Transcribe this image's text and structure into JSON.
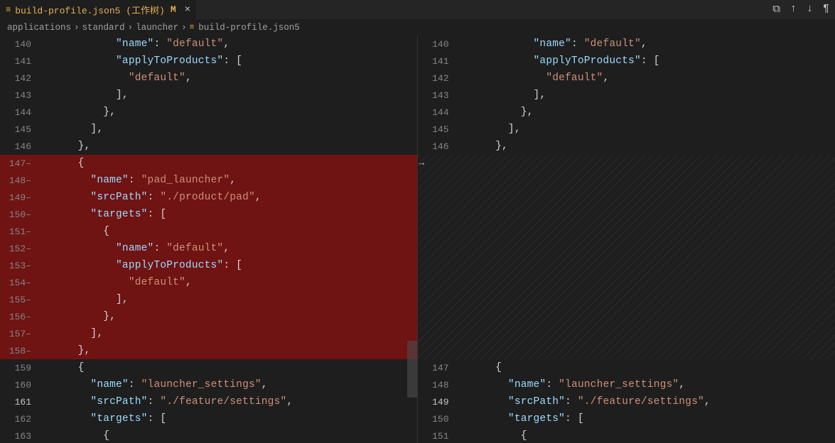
{
  "tab": {
    "filename": "build-profile.json5 (工作树)",
    "modifier": "M"
  },
  "toolbar": {
    "icon1": "⧉",
    "icon2": "↑",
    "icon3": "↓",
    "icon4": "¶"
  },
  "breadcrumb": {
    "segments": [
      "applications",
      "standard",
      "launcher"
    ],
    "file": "build-profile.json5"
  },
  "left": {
    "lines": [
      {
        "n": "140",
        "indent": 10,
        "removed": false,
        "tokens": [
          {
            "t": "key",
            "v": "\"name\""
          },
          {
            "t": "punct",
            "v": ": "
          },
          {
            "t": "string",
            "v": "\"default\""
          },
          {
            "t": "punct",
            "v": ","
          }
        ]
      },
      {
        "n": "141",
        "indent": 10,
        "removed": false,
        "tokens": [
          {
            "t": "key",
            "v": "\"applyToProducts\""
          },
          {
            "t": "punct",
            "v": ": ["
          }
        ]
      },
      {
        "n": "142",
        "indent": 12,
        "removed": false,
        "tokens": [
          {
            "t": "string",
            "v": "\"default\""
          },
          {
            "t": "punct",
            "v": ","
          }
        ]
      },
      {
        "n": "143",
        "indent": 10,
        "removed": false,
        "tokens": [
          {
            "t": "punct",
            "v": "],"
          }
        ]
      },
      {
        "n": "144",
        "indent": 8,
        "removed": false,
        "tokens": [
          {
            "t": "punct",
            "v": "},"
          }
        ]
      },
      {
        "n": "145",
        "indent": 6,
        "removed": false,
        "tokens": [
          {
            "t": "punct",
            "v": "],"
          }
        ]
      },
      {
        "n": "146",
        "indent": 4,
        "removed": false,
        "tokens": [
          {
            "t": "punct",
            "v": "},"
          }
        ]
      },
      {
        "n": "147",
        "indent": 4,
        "removed": true,
        "suffix": "–",
        "tokens": [
          {
            "t": "punct",
            "v": "{"
          }
        ]
      },
      {
        "n": "148",
        "indent": 6,
        "removed": true,
        "suffix": "–",
        "tokens": [
          {
            "t": "key",
            "v": "\"name\""
          },
          {
            "t": "punct",
            "v": ": "
          },
          {
            "t": "string",
            "v": "\"pad_launcher\""
          },
          {
            "t": "punct",
            "v": ","
          }
        ]
      },
      {
        "n": "149",
        "indent": 6,
        "removed": true,
        "suffix": "–",
        "tokens": [
          {
            "t": "key",
            "v": "\"srcPath\""
          },
          {
            "t": "punct",
            "v": ": "
          },
          {
            "t": "string",
            "v": "\"./product/pad\""
          },
          {
            "t": "punct",
            "v": ","
          }
        ]
      },
      {
        "n": "150",
        "indent": 6,
        "removed": true,
        "suffix": "–",
        "tokens": [
          {
            "t": "key",
            "v": "\"targets\""
          },
          {
            "t": "punct",
            "v": ": ["
          }
        ]
      },
      {
        "n": "151",
        "indent": 8,
        "removed": true,
        "suffix": "–",
        "tokens": [
          {
            "t": "punct",
            "v": "{"
          }
        ]
      },
      {
        "n": "152",
        "indent": 10,
        "removed": true,
        "suffix": "–",
        "tokens": [
          {
            "t": "key",
            "v": "\"name\""
          },
          {
            "t": "punct",
            "v": ": "
          },
          {
            "t": "string",
            "v": "\"default\""
          },
          {
            "t": "punct",
            "v": ","
          }
        ]
      },
      {
        "n": "153",
        "indent": 10,
        "removed": true,
        "suffix": "–",
        "tokens": [
          {
            "t": "key",
            "v": "\"applyToProducts\""
          },
          {
            "t": "punct",
            "v": ": ["
          }
        ]
      },
      {
        "n": "154",
        "indent": 12,
        "removed": true,
        "suffix": "–",
        "tokens": [
          {
            "t": "string",
            "v": "\"default\""
          },
          {
            "t": "punct",
            "v": ","
          }
        ]
      },
      {
        "n": "155",
        "indent": 10,
        "removed": true,
        "suffix": "–",
        "tokens": [
          {
            "t": "punct",
            "v": "],"
          }
        ]
      },
      {
        "n": "156",
        "indent": 8,
        "removed": true,
        "suffix": "–",
        "tokens": [
          {
            "t": "punct",
            "v": "},"
          }
        ]
      },
      {
        "n": "157",
        "indent": 6,
        "removed": true,
        "suffix": "–",
        "tokens": [
          {
            "t": "punct",
            "v": "],"
          }
        ]
      },
      {
        "n": "158",
        "indent": 4,
        "removed": true,
        "suffix": "–",
        "tokens": [
          {
            "t": "punct",
            "v": "},"
          }
        ]
      },
      {
        "n": "159",
        "indent": 4,
        "removed": false,
        "tokens": [
          {
            "t": "punct",
            "v": "{"
          }
        ]
      },
      {
        "n": "160",
        "indent": 6,
        "removed": false,
        "tokens": [
          {
            "t": "key",
            "v": "\"name\""
          },
          {
            "t": "punct",
            "v": ": "
          },
          {
            "t": "string",
            "v": "\"launcher_settings\""
          },
          {
            "t": "punct",
            "v": ","
          }
        ]
      },
      {
        "n": "161",
        "indent": 6,
        "removed": false,
        "highlight": true,
        "tokens": [
          {
            "t": "key",
            "v": "\"srcPath\""
          },
          {
            "t": "punct",
            "v": ": "
          },
          {
            "t": "string",
            "v": "\"./feature/settings\""
          },
          {
            "t": "punct",
            "v": ","
          }
        ]
      },
      {
        "n": "162",
        "indent": 6,
        "removed": false,
        "tokens": [
          {
            "t": "key",
            "v": "\"targets\""
          },
          {
            "t": "punct",
            "v": ": ["
          }
        ]
      },
      {
        "n": "163",
        "indent": 8,
        "removed": false,
        "tokens": [
          {
            "t": "punct",
            "v": "{"
          }
        ]
      }
    ]
  },
  "right": {
    "lines": [
      {
        "n": "140",
        "indent": 10,
        "tokens": [
          {
            "t": "key",
            "v": "\"name\""
          },
          {
            "t": "punct",
            "v": ": "
          },
          {
            "t": "string",
            "v": "\"default\""
          },
          {
            "t": "punct",
            "v": ","
          }
        ]
      },
      {
        "n": "141",
        "indent": 10,
        "tokens": [
          {
            "t": "key",
            "v": "\"applyToProducts\""
          },
          {
            "t": "punct",
            "v": ": ["
          }
        ]
      },
      {
        "n": "142",
        "indent": 12,
        "tokens": [
          {
            "t": "string",
            "v": "\"default\""
          },
          {
            "t": "punct",
            "v": ","
          }
        ]
      },
      {
        "n": "143",
        "indent": 10,
        "tokens": [
          {
            "t": "punct",
            "v": "],"
          }
        ]
      },
      {
        "n": "144",
        "indent": 8,
        "tokens": [
          {
            "t": "punct",
            "v": "},"
          }
        ]
      },
      {
        "n": "145",
        "indent": 6,
        "tokens": [
          {
            "t": "punct",
            "v": "],"
          }
        ]
      },
      {
        "n": "146",
        "indent": 4,
        "tokens": [
          {
            "t": "punct",
            "v": "},"
          }
        ]
      },
      {
        "filler": true,
        "rows": 12
      },
      {
        "n": "147",
        "indent": 4,
        "tokens": [
          {
            "t": "punct",
            "v": "{"
          }
        ]
      },
      {
        "n": "148",
        "indent": 6,
        "tokens": [
          {
            "t": "key",
            "v": "\"name\""
          },
          {
            "t": "punct",
            "v": ": "
          },
          {
            "t": "string",
            "v": "\"launcher_settings\""
          },
          {
            "t": "punct",
            "v": ","
          }
        ]
      },
      {
        "n": "149",
        "indent": 6,
        "highlight": true,
        "tokens": [
          {
            "t": "key",
            "v": "\"srcPath\""
          },
          {
            "t": "punct",
            "v": ": "
          },
          {
            "t": "string",
            "v": "\"./feature/settings\""
          },
          {
            "t": "punct",
            "v": ","
          }
        ]
      },
      {
        "n": "150",
        "indent": 6,
        "tokens": [
          {
            "t": "key",
            "v": "\"targets\""
          },
          {
            "t": "punct",
            "v": ": ["
          }
        ]
      },
      {
        "n": "151",
        "indent": 8,
        "tokens": [
          {
            "t": "punct",
            "v": "{"
          }
        ]
      }
    ]
  },
  "revertArrowTopPx": 172
}
